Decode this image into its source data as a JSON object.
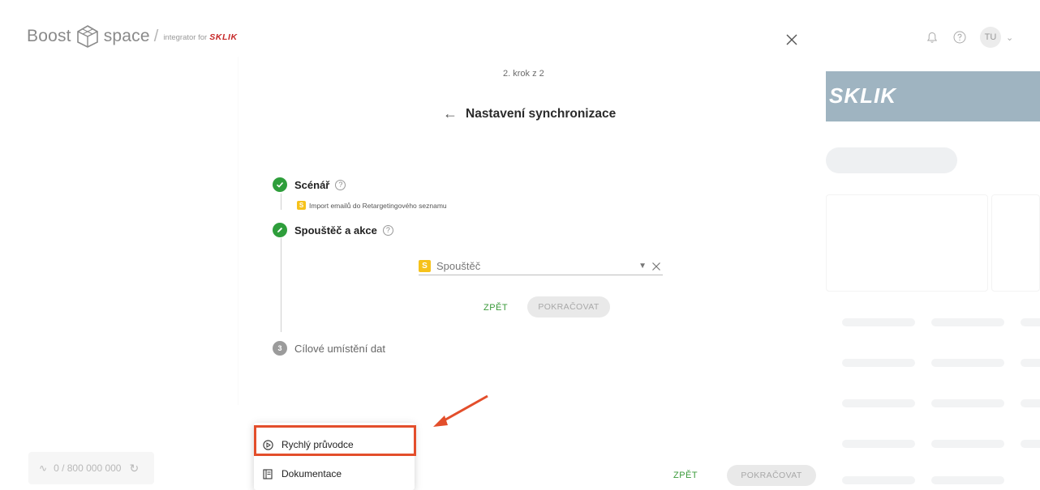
{
  "brand": {
    "boost": "Boost",
    "space": "space",
    "slash": "/",
    "integrator": "integrator for",
    "partner": "SKLIK"
  },
  "topbar": {
    "close_icon": "close-icon",
    "bell_icon": "bell-icon",
    "help_icon": "help-icon",
    "avatar_initials": "TU"
  },
  "right_panel": {
    "banner_text": "SKLIK",
    "banner_color": "#9fb4c1"
  },
  "left_panel": {
    "counter": "0 / 800 000 000"
  },
  "wizard": {
    "step_count": "2. krok z 2",
    "title": "Nastavení synchronizace",
    "steps": [
      {
        "label": "Scénář",
        "state": "done",
        "sub": "Import emailů do Retargetingového seznamu"
      },
      {
        "label": "Spouštěč a akce",
        "state": "active"
      },
      {
        "label": "Cílové umístění dat",
        "state": "pending",
        "number": "3"
      }
    ],
    "trigger_select": {
      "value": "Spouštěč"
    },
    "inner_back": "ZPĚT",
    "inner_continue": "POKRAČOVAT",
    "footer_back": "ZPĚT",
    "footer_continue": "POKRAČOVAT"
  },
  "menu": {
    "items": [
      {
        "label": "Rychlý průvodce",
        "icon": "play-circle-icon"
      },
      {
        "label": "Dokumentace",
        "icon": "document-icon"
      }
    ]
  },
  "colors": {
    "accent_green": "#2e9e3b",
    "highlight_red": "#e34e2b",
    "sklik_yellow": "#f6c21b"
  }
}
